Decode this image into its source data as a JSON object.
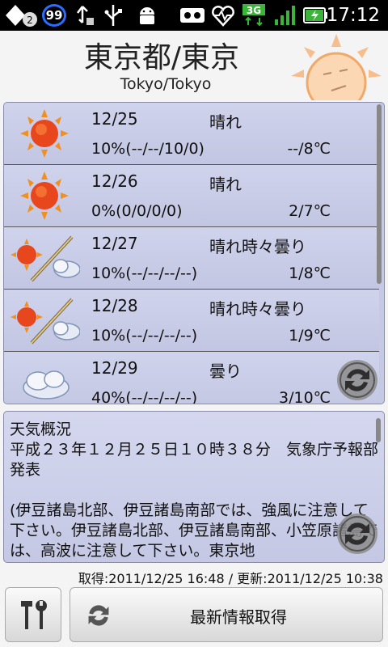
{
  "status_bar": {
    "notif_count": "2",
    "badge_count": "99",
    "network": "3G",
    "time": "17:12"
  },
  "header": {
    "city_ja": "東京都/東京",
    "city_en": "Tokyo/Tokyo"
  },
  "forecast": [
    {
      "date": "12/25",
      "condition": "晴れ",
      "rain": "10%(--/--/10/0)",
      "temp": "--/8℃",
      "icon": "sunny-icon"
    },
    {
      "date": "12/26",
      "condition": "晴れ",
      "rain": "0%(0/0/0/0)",
      "temp": "2/7℃",
      "icon": "sunny-icon"
    },
    {
      "date": "12/27",
      "condition": "晴れ時々曇り",
      "rain": "10%(--/--/--/--)",
      "temp": "1/8℃",
      "icon": "sun-cloud-icon"
    },
    {
      "date": "12/28",
      "condition": "晴れ時々曇り",
      "rain": "10%(--/--/--/--)",
      "temp": "1/9℃",
      "icon": "sun-cloud-icon"
    },
    {
      "date": "12/29",
      "condition": "曇り",
      "rain": "40%(--/--/--/--)",
      "temp": "3/10℃",
      "icon": "cloudy-icon"
    }
  ],
  "overview": {
    "text": "天気概況\n平成２３年１２月２５日１０時３８分　気象庁予報部発表\n\n(伊豆諸島北部、伊豆諸島南部では、強風に注意して下さい。伊豆諸島北部、伊豆諸島南部、小笠原諸島では、高波に注意して下さい。東京地"
  },
  "timestamps": "取得:2011/12/25 16:48 / 更新:2011/12/25 10:38",
  "buttons": {
    "refresh_label": "最新情報取得"
  }
}
